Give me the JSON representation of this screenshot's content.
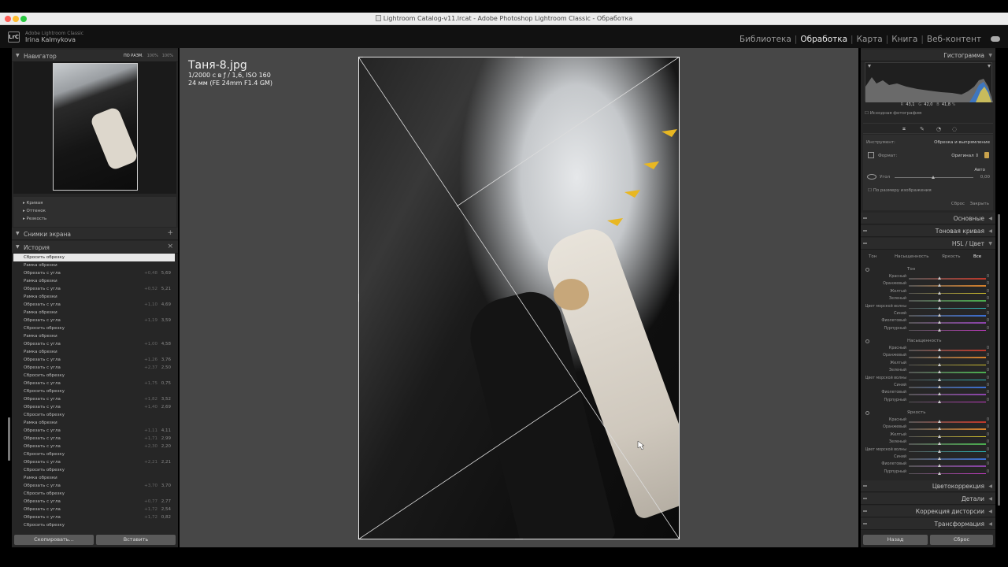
{
  "window": {
    "title": "Lightroom Catalog-v11.lrcat - Adobe Photoshop Lightroom Classic - Обработка",
    "lights": [
      "#fe5f57",
      "#febc2e",
      "#28c840"
    ]
  },
  "app": {
    "logo": "LrC",
    "brand": "Adobe Lightroom Classic",
    "user": "Irina Kalmykova",
    "modules": [
      "Библиотека",
      "Обработка",
      "Карта",
      "Книга",
      "Веб-контент"
    ],
    "active_module": "Обработка"
  },
  "navigator": {
    "title": "Навигатор",
    "zoom": [
      "ПО РАЗМ.",
      "100%",
      "100%"
    ]
  },
  "subpanel": [
    "Кривая",
    "Оттенок",
    "Резкость"
  ],
  "snapshots": {
    "title": "Снимки экрана",
    "add": "+"
  },
  "history": {
    "title": "История",
    "close": "×",
    "items": [
      {
        "label": "Сбросить обрезку",
        "v1": "",
        "v2": "",
        "selected": true
      },
      {
        "label": "Рамка обрезки",
        "v1": "",
        "v2": ""
      },
      {
        "label": "Обрезать с угла",
        "v1": "+0,48",
        "v2": "5,69"
      },
      {
        "label": "Рамка обрезки",
        "v1": "",
        "v2": ""
      },
      {
        "label": "Обрезать с угла",
        "v1": "+0,52",
        "v2": "5,21"
      },
      {
        "label": "Рамка обрезки",
        "v1": "",
        "v2": ""
      },
      {
        "label": "Обрезать с угла",
        "v1": "+1,10",
        "v2": "4,69"
      },
      {
        "label": "Рамка обрезки",
        "v1": "",
        "v2": ""
      },
      {
        "label": "Обрезать с угла",
        "v1": "+1,19",
        "v2": "3,59"
      },
      {
        "label": "Сбросить обрезку",
        "v1": "",
        "v2": ""
      },
      {
        "label": "Рамка обрезки",
        "v1": "",
        "v2": ""
      },
      {
        "label": "Обрезать с угла",
        "v1": "+1,00",
        "v2": "4,58"
      },
      {
        "label": "Рамка обрезки",
        "v1": "",
        "v2": ""
      },
      {
        "label": "Обрезать с угла",
        "v1": "+1,26",
        "v2": "3,76"
      },
      {
        "label": "Обрезать с угла",
        "v1": "+2,37",
        "v2": "2,50"
      },
      {
        "label": "Сбросить обрезку",
        "v1": "",
        "v2": ""
      },
      {
        "label": "Обрезать с угла",
        "v1": "+1,75",
        "v2": "0,75"
      },
      {
        "label": "Сбросить обрезку",
        "v1": "",
        "v2": ""
      },
      {
        "label": "Обрезать с угла",
        "v1": "+1,82",
        "v2": "3,52"
      },
      {
        "label": "Обрезать с угла",
        "v1": "+1,40",
        "v2": "2,69"
      },
      {
        "label": "Сбросить обрезку",
        "v1": "",
        "v2": ""
      },
      {
        "label": "Рамка обрезки",
        "v1": "",
        "v2": ""
      },
      {
        "label": "Обрезать с угла",
        "v1": "+1,11",
        "v2": "4,11"
      },
      {
        "label": "Обрезать с угла",
        "v1": "+1,71",
        "v2": "2,99"
      },
      {
        "label": "Обрезать с угла",
        "v1": "+2,30",
        "v2": "2,20"
      },
      {
        "label": "Сбросить обрезку",
        "v1": "",
        "v2": ""
      },
      {
        "label": "Обрезать с угла",
        "v1": "+2,21",
        "v2": "2,21"
      },
      {
        "label": "Сбросить обрезку",
        "v1": "",
        "v2": ""
      },
      {
        "label": "Рамка обрезки",
        "v1": "",
        "v2": ""
      },
      {
        "label": "Обрезать с угла",
        "v1": "+3,70",
        "v2": "3,70"
      },
      {
        "label": "Сбросить обрезку",
        "v1": "",
        "v2": ""
      },
      {
        "label": "Обрезать с угла",
        "v1": "+0,77",
        "v2": "2,77"
      },
      {
        "label": "Обрезать с угла",
        "v1": "+1,72",
        "v2": "2,54"
      },
      {
        "label": "Обрезать с угла",
        "v1": "+1,72",
        "v2": "0,82"
      },
      {
        "label": "Сбросить обрезку",
        "v1": "",
        "v2": ""
      }
    ]
  },
  "left_buttons": {
    "copy": "Скопировать...",
    "paste": "Вставить"
  },
  "photo_info": {
    "filename": "Таня-8.jpg",
    "exposure": "1/2000 с в ƒ / 1,6, ISO 160",
    "lens": "24 мм (FE 24mm F1.4 GM)"
  },
  "histogram": {
    "title": "Гистограмма",
    "r_label": "R",
    "r": "43,1",
    "g_label": "G",
    "g": "42,0",
    "b_label": "B",
    "b": "41,8",
    "pct": "%",
    "original_label": "Исходная фотография"
  },
  "crop_tool": {
    "tool_label": "Инструмент:",
    "tool_name": "Обрезка и выпрямление",
    "format_label": "Формат:",
    "format_value": "Оригинал",
    "auto_label": "Авто",
    "angle_label": "Угол",
    "angle_value": "0,00",
    "fit_label": "По размеру изображения",
    "reset_label": "Сброс",
    "close_label": "Закрыть"
  },
  "sections": {
    "basic": "Основные",
    "tone_curve": "Тоновая кривая",
    "hsl": "HSL / Цвет",
    "color_grading": "Цветокоррекция",
    "detail": "Детали",
    "lens": "Коррекция дисторсии",
    "transform": "Трансформация"
  },
  "hsl": {
    "tabs": [
      "Тон",
      "Насыщенность",
      "Яркость",
      "Все"
    ],
    "active_tab": "Все",
    "groups": [
      {
        "title": "Тон",
        "rows": [
          "Красный",
          "Оранжевый",
          "Желтый",
          "Зеленый",
          "Цвет морской волны",
          "Синий",
          "Фиолетовый",
          "Пурпурный"
        ]
      },
      {
        "title": "Насыщенность",
        "rows": [
          "Красный",
          "Оранжевый",
          "Желтый",
          "Зеленый",
          "Цвет морской волны",
          "Синий",
          "Фиолетовый",
          "Пурпурный"
        ]
      },
      {
        "title": "Яркость",
        "rows": [
          "Красный",
          "Оранжевый",
          "Желтый",
          "Зеленый",
          "Цвет морской волны",
          "Синий",
          "Фиолетовый",
          "Пурпурный"
        ]
      }
    ],
    "value": "0",
    "colors": [
      "#c0392b",
      "#d9822b",
      "#d4c22b",
      "#4caf50",
      "#2bb5b5",
      "#3b6fd4",
      "#8e44ad",
      "#c43bc4"
    ]
  },
  "right_buttons": {
    "prev": "Назад",
    "reset": "Сброс"
  }
}
